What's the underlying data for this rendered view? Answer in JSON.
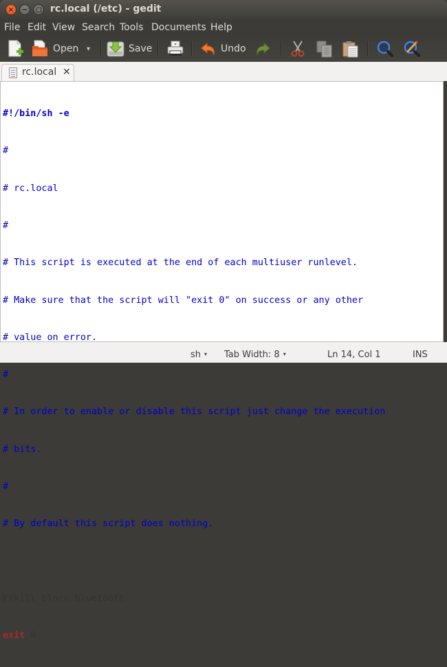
{
  "window": {
    "title": "rc.local (/etc) - gedit",
    "controls": {
      "close": "×",
      "minimize": "–",
      "maximize": "□"
    }
  },
  "menubar": {
    "items": [
      "File",
      "Edit",
      "View",
      "Search",
      "Tools",
      "Documents",
      "Help"
    ]
  },
  "toolbar": {
    "new_icon": "new-document-icon",
    "open_label": "Open",
    "open_dropdown": "▾",
    "save_label": "Save",
    "print_icon": "print-icon",
    "undo_label": "Undo",
    "redo_icon": "redo-icon",
    "cut_icon": "cut-icon",
    "copy_icon": "copy-icon",
    "paste_icon": "paste-icon",
    "find_icon": "find-icon",
    "replace_icon": "find-replace-icon"
  },
  "tabs": [
    {
      "label": "rc.local",
      "close": "✕",
      "active": true
    }
  ],
  "editor": {
    "lines": [
      {
        "text": "#!/bin/sh -e",
        "style": "shebang"
      },
      {
        "text": "#",
        "style": "cmt"
      },
      {
        "text": "# rc.local",
        "style": "cmt"
      },
      {
        "text": "#",
        "style": "cmt"
      },
      {
        "text": "# This script is executed at the end of each multiuser runlevel.",
        "style": "cmt"
      },
      {
        "text": "# Make sure that the script will \"exit 0\" on success or any other",
        "style": "cmt"
      },
      {
        "text": "# value on error.",
        "style": "cmt"
      },
      {
        "text": "#",
        "style": "cmt"
      },
      {
        "text": "# In order to enable or disable this script just change the execution",
        "style": "cmt"
      },
      {
        "text": "# bits.",
        "style": "cmt"
      },
      {
        "text": "#",
        "style": "cmt"
      },
      {
        "text": "# By default this script does nothing.",
        "style": "cmt"
      },
      {
        "text": "",
        "style": "plain"
      },
      {
        "text": "rfkill block bluetooth",
        "style": "plain"
      },
      {
        "keyword": "exit",
        "rest": " 0",
        "style": "kw"
      }
    ],
    "colors": {
      "comment": "#0000cc",
      "keyword": "#a52a2a",
      "text": "#333333"
    }
  },
  "statusbar": {
    "language": "sh",
    "tab_width": "Tab Width: 8",
    "position": "Ln 14, Col 1",
    "mode": "INS",
    "dropdown": "▾"
  }
}
